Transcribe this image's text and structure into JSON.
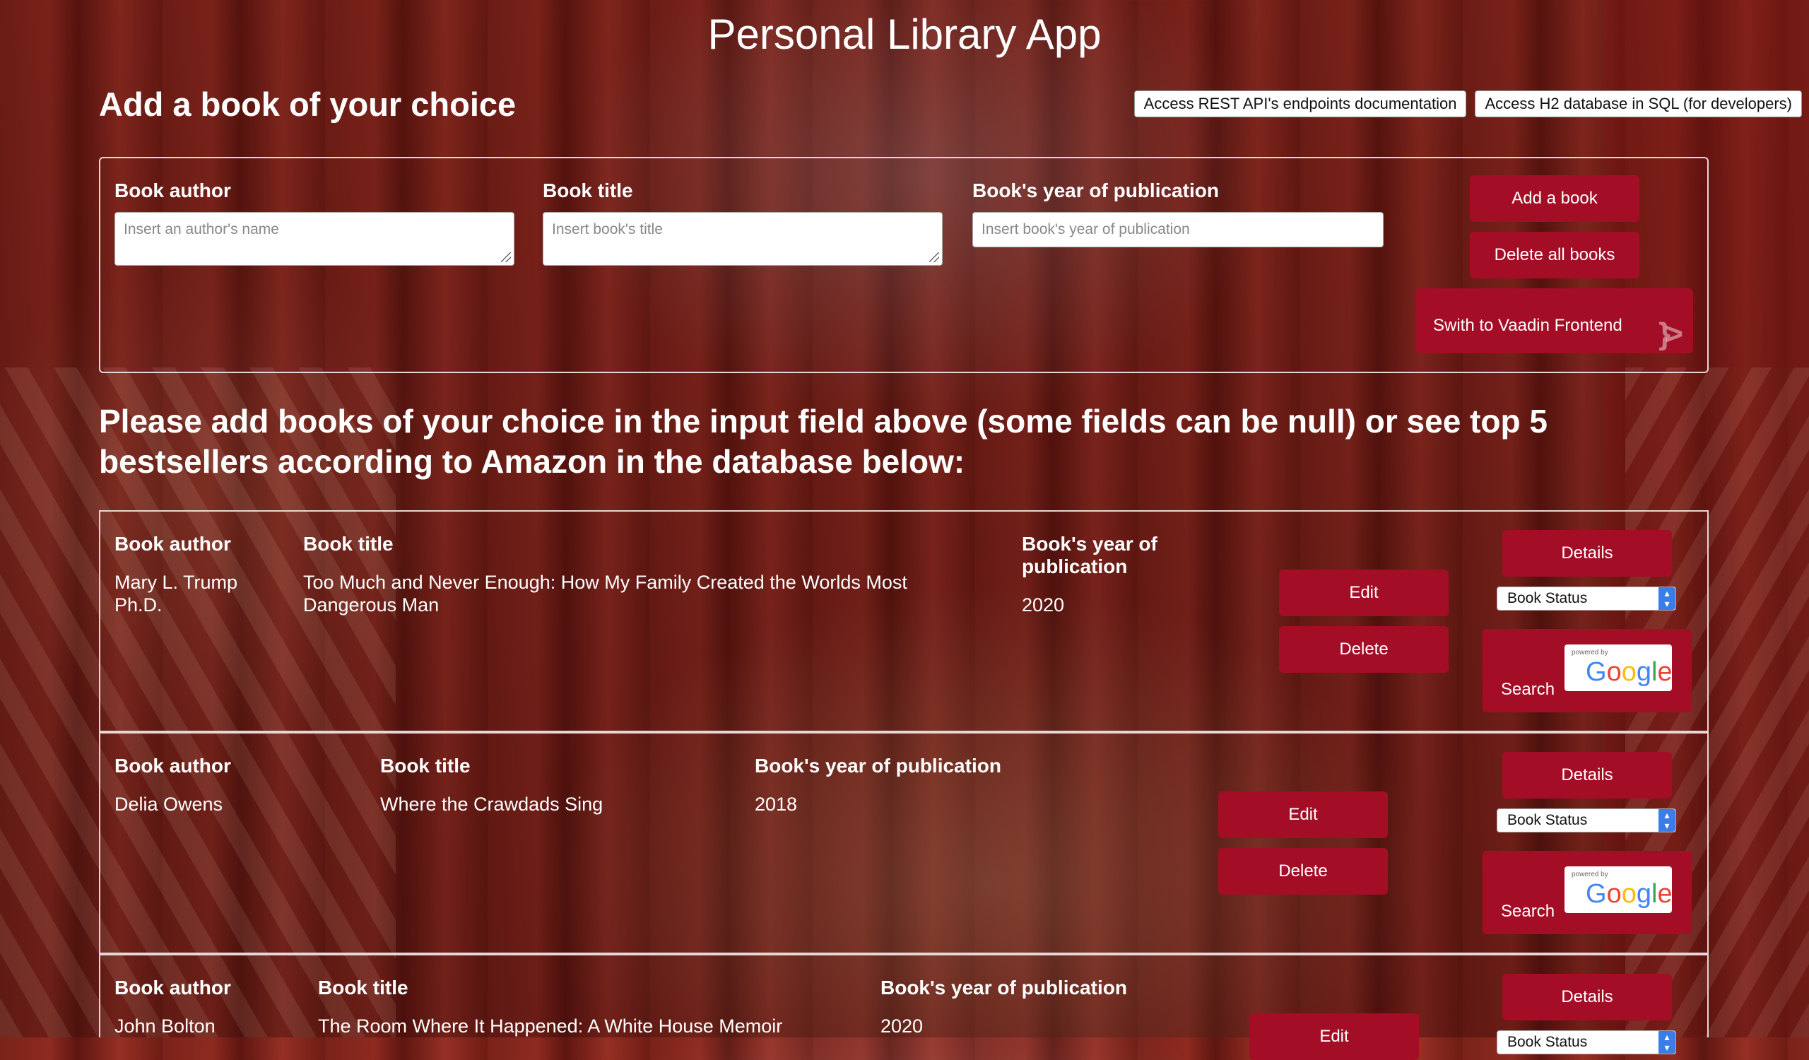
{
  "app_title": "Personal Library App",
  "add_section": {
    "heading": "Add a book of your choice",
    "author_label": "Book author",
    "author_placeholder": "Insert an author's name",
    "title_label": "Book title",
    "title_placeholder": "Insert book's title",
    "year_label": "Book's year of publication",
    "year_placeholder": "Insert book's year of publication",
    "add_button": "Add a book",
    "delete_all_button": "Delete all books",
    "vaadin_button": "Swith to Vaadin Frontend"
  },
  "top_links": {
    "rest_docs": "Access REST API's endpoints documentation",
    "h2_console": "Access H2 database in SQL (for developers)"
  },
  "intro_text": "Please add books of your choice in the input field above (some fields can be null) or see top 5 bestsellers according to Amazon in the database below:",
  "book_labels": {
    "author": "Book author",
    "title": "Book title",
    "year": "Book's year of publication",
    "edit": "Edit",
    "delete": "Delete",
    "details": "Details",
    "status": "Book Status",
    "search": "Search",
    "powered_by": "powered by"
  },
  "books": [
    {
      "author": "Mary L. Trump Ph.D.",
      "title": "Too Much and Never Enough: How My Family Created the Worlds Most Dangerous Man",
      "year": "2020"
    },
    {
      "author": "Delia Owens",
      "title": "Where the Crawdads Sing",
      "year": "2018"
    },
    {
      "author": "John Bolton",
      "title": "The Room Where It Happened: A White House Memoir",
      "year": "2020"
    }
  ],
  "colors": {
    "accent": "#a30e26",
    "panel_border": "#e8d6d6"
  }
}
